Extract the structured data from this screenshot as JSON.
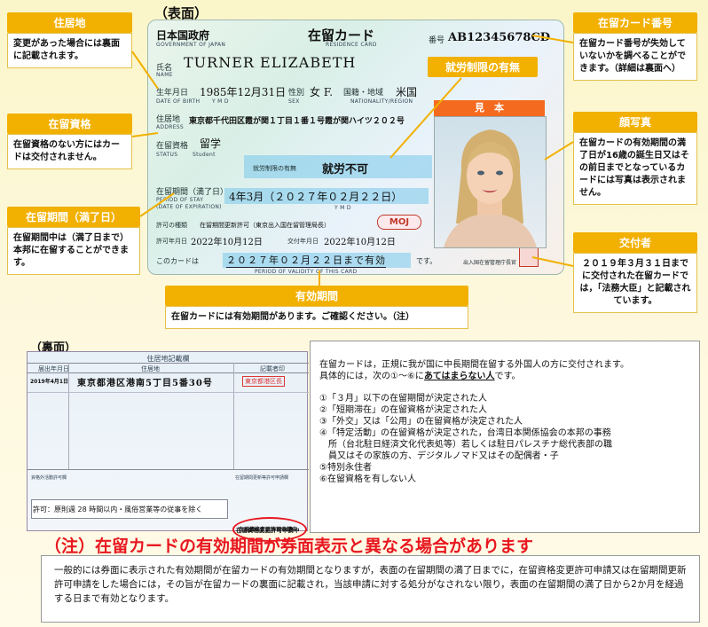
{
  "front_label": "（表面）",
  "back_label": "（裏面）",
  "callouts": {
    "address": {
      "head": "住居地",
      "body": "変更があった場合には裏面に記載されます。"
    },
    "status": {
      "head": "在留資格",
      "body": "在留資格のない方にはカードは交付されません。"
    },
    "period": {
      "head": "在留期間（満了日）",
      "body": "在留期間中は（満了日まで）本邦に在留することができます。"
    },
    "card_number": {
      "head": "在留カード番号",
      "body": "在留カード番号が失効していないかを調べることができます。（詳細は裏面へ）"
    },
    "work": {
      "head": "就労制限の有無"
    },
    "photo": {
      "head": "顔写真",
      "body": "在留カードの有効期間の満了日が16歳の誕生日又はその前日までとなっているカードには写真は表示されません。"
    },
    "issuer": {
      "head": "交付者",
      "body": "２０１９年３月３１日までに交付された在留カードでは，「法務大臣」と記載されています。"
    },
    "validity": {
      "head": "有効期間",
      "body": "在留カードには有効期間があります。ご確認ください。（注）"
    }
  },
  "card": {
    "country": "日本国政府",
    "country_en": "GOVERNMENT OF JAPAN",
    "title": "在留カード",
    "title_en": "RESIDENCE CARD",
    "number_label": "番号",
    "number": "AB12345678CD",
    "name_label": "氏名",
    "name_en": "NAME",
    "name": "TURNER ELIZABETH",
    "dob_label": "生年月日",
    "dob_en": "DATE OF BIRTH",
    "dob": "1985年12月31日",
    "dob_ymd": "Y  M  D",
    "sex_label": "性別",
    "sex_en": "SEX",
    "sex": "女 F.",
    "nat_label": "国籍・地域",
    "nat_en": "NATIONALITY/REGION",
    "nationality": "米国",
    "addr_label": "住居地",
    "addr_en": "ADDRESS",
    "address": "東京都千代田区霞が関１丁目１番１号霞が関ハイツ２０２号",
    "status_label": "在留資格",
    "status_en": "STATUS",
    "status": "留学",
    "status_sub": "Student",
    "work_label": "就労制限の有無",
    "work": "就労不可",
    "period_label": "在留期間（満了日）",
    "period_en1": "PERIOD OF STAY",
    "period_en2": "(DATE OF EXPIRATION)",
    "period": "4年3月（２０２７年０２月２２日）",
    "period_ymd": "Y    M    D",
    "permit_label": "許可の種類",
    "permit": "在留期間更新許可（東京出入国在留管理局長）",
    "permit_date_label": "許可年月日",
    "permit_date": "2022年10月12日",
    "issue_label": "交付年月日",
    "issue_date": "2022年10月12日",
    "moj": "MOJ",
    "photo_header": "見　本",
    "validity_prefix": "このカードは",
    "validity_date": "２０２７年０２月２２日まで有効",
    "validity_suffix": "です。",
    "validity_en": "PERIOD OF VALIDITY OF THIS CARD",
    "issuer_stamp": "出入国在留管理庁長官"
  },
  "back": {
    "title": "住居地記載欄",
    "col1": "届出年月日",
    "col2": "住居地",
    "col3": "記載者印",
    "entry_date": "2019年4月1日",
    "entry_address": "東京都港区港南5丁目5番30号",
    "entry_stamp": "東京都港区長",
    "permission_label": "資格外活動許可欄",
    "permission": "許可：原則週 28 時間以内・風俗営業等の従事を除く",
    "application_label": "在留期間更新等許可申請欄",
    "application": "在留資格変更許可申請中"
  },
  "info": {
    "line1": "在留カードは，正規に我が国に中長期間在留する外国人の方に交付されます。",
    "line2_prefix": "具体的には，次の①～⑥に",
    "line2_emph": "あてはまらない人",
    "line2_suffix": "です。",
    "items": [
      "①「３月」以下の在留期間が決定された人",
      "②「短期滞在」の在留資格が決定された人",
      "③「外交」又は「公用」の在留資格が決定された人",
      "④「特定活動」の在留資格が決定された，台湾日本関係協会の本邦の事務",
      "　所（台北駐日経済文化代表処等）若しくは駐日パレスチナ総代表部の職",
      "　員又はその家族の方、デジタルノマド又はその配偶者・子",
      "⑤特別永住者",
      "⑥在留資格を有しない人"
    ]
  },
  "note": {
    "title": "（注）在留カードの有効期間が券面表示と異なる場合があります",
    "body": "一般的には券面に表示された有効期間が在留カードの有効期間となりますが，表面の在留期間の満了日までに，在留資格変更許可申請又は在留期間更新許可申請をした場合には，その旨が在留カードの裏面に記載され，当該申請に対する処分がなされない限り，表面の在留期間の満了日から2か月を経過する日まで有効となります。"
  },
  "colors": {
    "accent": "#f2b000",
    "note_red": "#e8171f",
    "highlight": "#78c8eb",
    "photo_header": "#f46a1f"
  }
}
